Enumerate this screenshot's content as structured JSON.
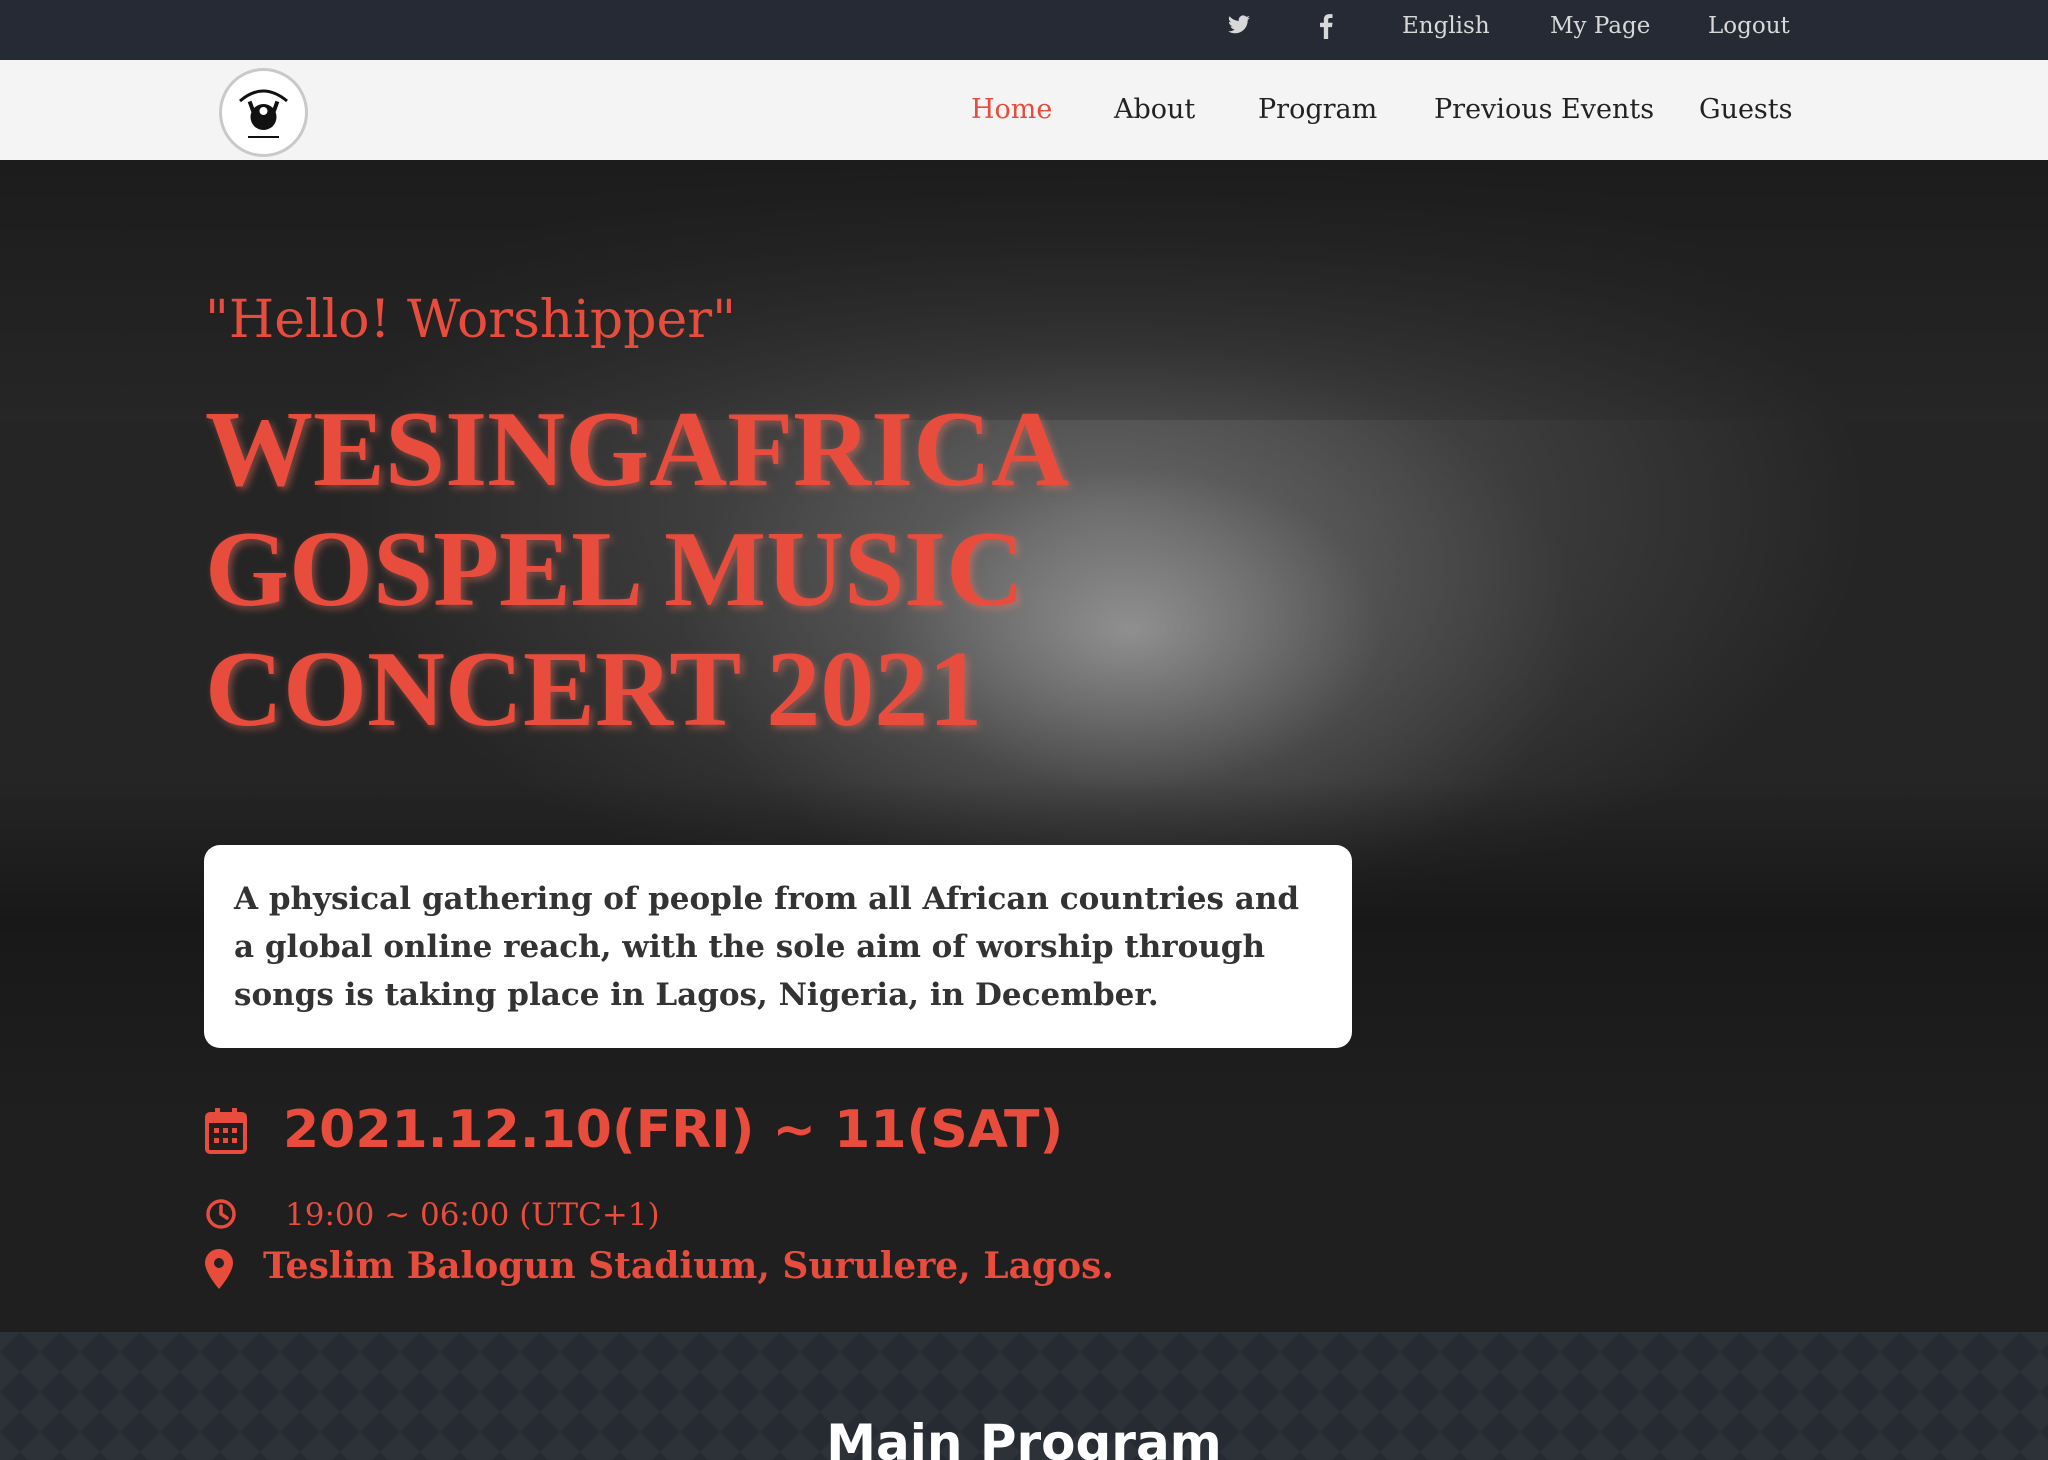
{
  "topbar": {
    "twitter_icon": "twitter-icon",
    "facebook_icon": "facebook-icon",
    "language": "English",
    "my_page": "My Page",
    "logout": "Logout"
  },
  "nav": {
    "logo_icon": "wesingafrica-logo",
    "items": [
      "Home",
      "About",
      "Program",
      "Previous Events",
      "Guests"
    ],
    "active": "Home"
  },
  "hero": {
    "greeting": "\"Hello! Worshipper\"",
    "title": "WESINGAFRICA GOSPEL MUSIC CONCERT 2021",
    "description": "A physical gathering of people from all African countries and a global online reach, with the sole aim of worship through songs is taking place in Lagos, Nigeria, in December.",
    "date": "2021.12.10(FRI) ~ 11(SAT)",
    "time": "19:00 ~ 06:00 (UTC+1)",
    "venue": "Teslim Balogun Stadium, Surulere, Lagos."
  },
  "program": {
    "heading": "Main Program"
  },
  "colors": {
    "accent": "#e84c3d",
    "topbar_bg": "#252a34",
    "navbar_bg": "#f4f4f4"
  }
}
